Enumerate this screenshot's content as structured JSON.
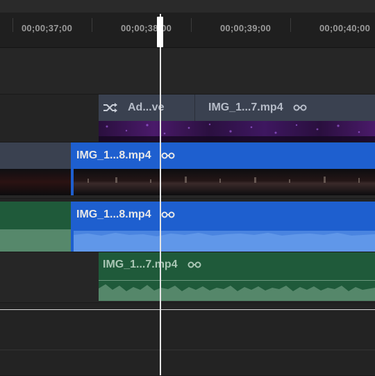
{
  "ruler": {
    "timecodes": [
      "00;00;37;00",
      "00;00;38;00",
      "00;00;39;00",
      "00;00;40;00"
    ]
  },
  "tracks": {
    "transition": {
      "icon": "shuffle-icon",
      "label": "Ad...ve",
      "clip_name": "IMG_1...7.mp4"
    },
    "video_main": {
      "clip_name": "IMG_1...8.mp4",
      "link_icon": "link-icon"
    },
    "audio_main": {
      "clip_name": "IMG_1...8.mp4",
      "link_icon": "link-icon"
    },
    "audio_second": {
      "clip_name": "IMG_1...7.mp4",
      "link_icon": "link-icon"
    }
  },
  "colors": {
    "blue_clip": "#1e5fcf",
    "green_clip": "#1f5a3a",
    "transition_header": "#3a4150",
    "playhead": "#ffffff"
  }
}
